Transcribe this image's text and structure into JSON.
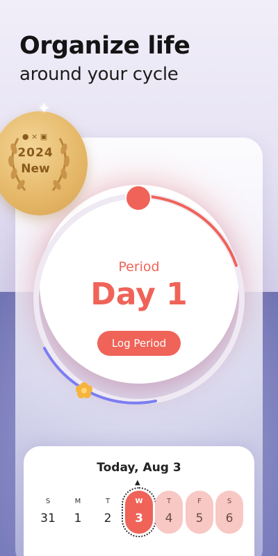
{
  "header": {
    "headline": "Organize life",
    "subline": "around your cycle"
  },
  "badge": {
    "platforms": " × ",
    "year": "2024",
    "label": "New"
  },
  "cycle": {
    "phase": "Period",
    "day": "Day 1",
    "log_button": "Log Period",
    "period_color": "#ef6358",
    "fertile_color": "#7b7ef0"
  },
  "calendar": {
    "title": "Today, Aug 3",
    "days": [
      {
        "letter": "S",
        "num": "31",
        "state": "normal"
      },
      {
        "letter": "M",
        "num": "1",
        "state": "normal"
      },
      {
        "letter": "T",
        "num": "2",
        "state": "normal"
      },
      {
        "letter": "W",
        "num": "3",
        "state": "today"
      },
      {
        "letter": "T",
        "num": "4",
        "state": "predicted"
      },
      {
        "letter": "F",
        "num": "5",
        "state": "predicted"
      },
      {
        "letter": "S",
        "num": "6",
        "state": "predicted"
      }
    ]
  },
  "icons": {
    "badge": [
      "apple-icon",
      "android-icon",
      "laurel-icon"
    ],
    "sparkle": "sparkle-icon",
    "ovulation": "flower-icon",
    "today_marker": "caret-up-icon"
  }
}
